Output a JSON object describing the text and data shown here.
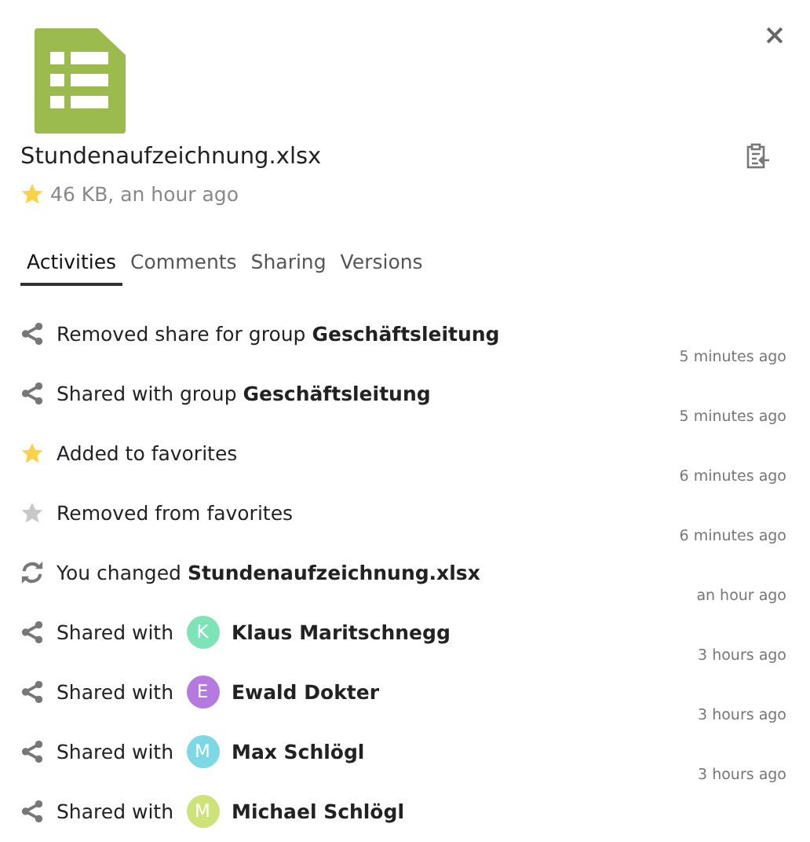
{
  "file": {
    "name": "Stundenaufzeichnung.xlsx",
    "favorite": true,
    "meta": "46 KB, an hour ago"
  },
  "tabs": [
    {
      "label": "Activities",
      "selected": true
    },
    {
      "label": "Comments",
      "selected": false
    },
    {
      "label": "Sharing",
      "selected": false
    },
    {
      "label": "Versions",
      "selected": false
    }
  ],
  "activities": [
    {
      "kind": "share",
      "text": "Removed share for group **Geschäftsleitung**",
      "time": "5 minutes ago"
    },
    {
      "kind": "share",
      "text": "Shared with group **Geschäftsleitung**",
      "time": "5 minutes ago"
    },
    {
      "kind": "favorite",
      "text": "Added to favorites",
      "time": "6 minutes ago"
    },
    {
      "kind": "unfavorite",
      "text": "Removed from favorites",
      "time": "6 minutes ago"
    },
    {
      "kind": "change",
      "text": "You changed **Stundenaufzeichnung.xlsx**",
      "time": "an hour ago"
    },
    {
      "kind": "share-user",
      "text": "Shared with",
      "avatar": "K",
      "color": "#7ee3b6",
      "user": "Klaus Maritschnegg",
      "time": "3 hours ago"
    },
    {
      "kind": "share-user",
      "text": "Shared with",
      "avatar": "E",
      "color": "#b57ae0",
      "user": "Ewald Dokter",
      "time": "3 hours ago"
    },
    {
      "kind": "share-user",
      "text": "Shared with",
      "avatar": "M",
      "color": "#7dd8e6",
      "user": "Max Schlögl",
      "time": "3 hours ago"
    },
    {
      "kind": "share-user",
      "text": "Shared with",
      "avatar": "M",
      "color": "#cde37a",
      "user": "Michael Schlögl"
    }
  ]
}
